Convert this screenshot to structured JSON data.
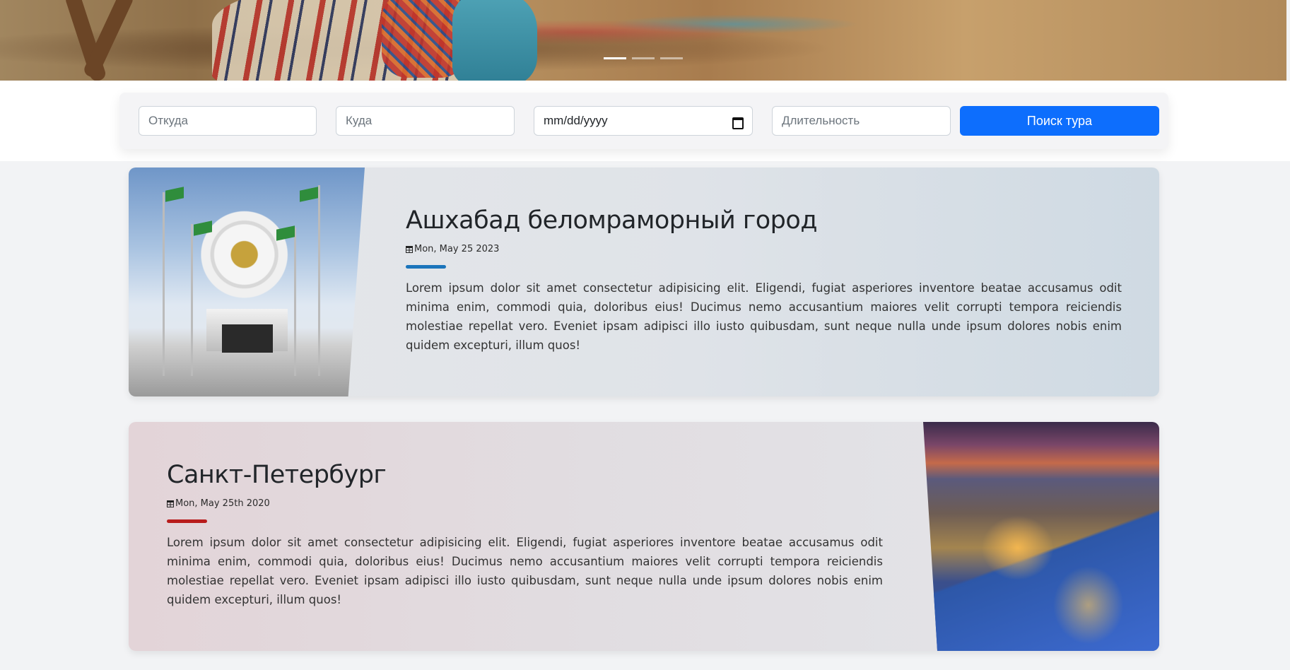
{
  "hero": {
    "indicators": [
      {
        "label": "Slide 1",
        "active": true
      },
      {
        "label": "Slide 2",
        "active": false
      },
      {
        "label": "Slide 3",
        "active": false
      }
    ]
  },
  "search": {
    "from_placeholder": "Откуда",
    "to_placeholder": "Куда",
    "date_value": "mm/dd/yyyy",
    "duration_placeholder": "Длительность",
    "submit_label": "Поиск тура",
    "accent_color": "#0d6efd"
  },
  "cards": [
    {
      "title": "Ашхабад беломраморный город",
      "date": "Mon, May 25 2023",
      "accent_color": "#1b75bb",
      "text": "Lorem ipsum dolor sit amet consectetur adipisicing elit. Eligendi, fugiat asperiores inventore beatae accusamus odit minima enim, commodi quia, doloribus eius! Ducimus nemo accusantium maiores velit corrupti tempora reiciendis molestiae repellat vero. Eveniet ipsam adipisci illo iusto quibusdam, sunt neque nulla unde ipsum dolores nobis enim quidem excepturi, illum quos!"
    },
    {
      "title": "Санкт-Петербург",
      "date": "Mon, May 25th 2020",
      "accent_color": "#b81c1c",
      "text": "Lorem ipsum dolor sit amet consectetur adipisicing elit. Eligendi, fugiat asperiores inventore beatae accusamus odit minima enim, commodi quia, doloribus eius! Ducimus nemo accusantium maiores velit corrupti tempora reiciendis molestiae repellat vero. Eveniet ipsam adipisci illo iusto quibusdam, sunt neque nulla unde ipsum dolores nobis enim quidem excepturi, illum quos!"
    }
  ]
}
